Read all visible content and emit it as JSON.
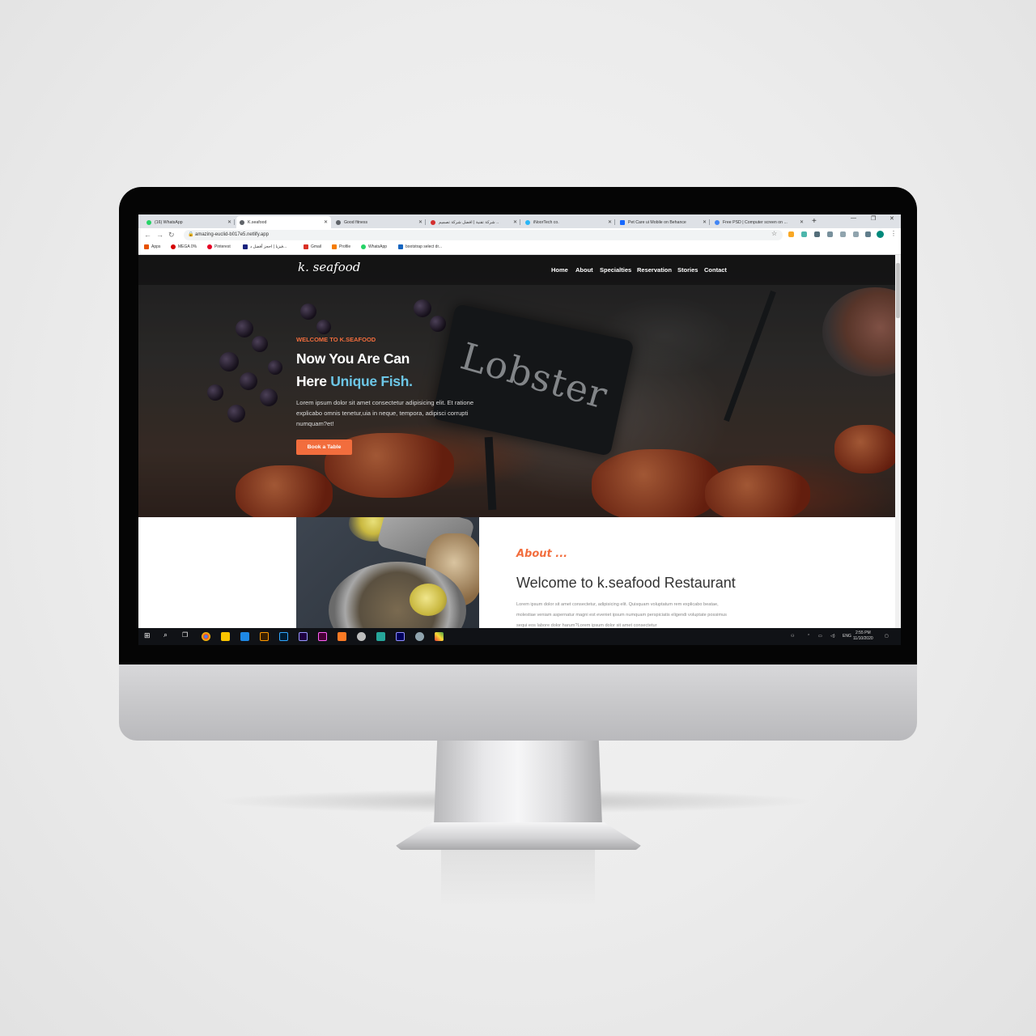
{
  "browser": {
    "tabs": [
      {
        "title": "(16) WhatsApp",
        "color": "#25d366"
      },
      {
        "title": "K.seafood",
        "color": "#5f6368"
      },
      {
        "title": "Good fitness",
        "color": "#5f6368"
      },
      {
        "title": "شركة تقنية | افضل شركة تصميم ..",
        "color": "#d32f2f"
      },
      {
        "title": "iNoorTech co.",
        "color": "#29b6f6"
      },
      {
        "title": "Pet Care ui Mobile on Behance",
        "color": "#1769ff"
      },
      {
        "title": "Free PSD | Computer screen on ...",
        "color": "#4285f4"
      }
    ],
    "new_tab": "+",
    "window_controls": {
      "minimize": "—",
      "restore": "❐",
      "close": "✕"
    },
    "address": "amazing-euclid-b017e5.netlify.app",
    "bookmarks": [
      {
        "label": "Apps",
        "color": "#e65100"
      },
      {
        "label": "MEGA 0%",
        "color": "#d50000"
      },
      {
        "label": "Pinterest",
        "color": "#e60023"
      },
      {
        "label": "فيزيا | احجز أفضل د...",
        "color": "#1a237e"
      },
      {
        "label": "Gmail",
        "color": "#d93025"
      },
      {
        "label": "Profile",
        "color": "#f57c00"
      },
      {
        "label": "WhatsApp",
        "color": "#25d366"
      },
      {
        "label": "bootstrap select dr...",
        "color": "#1565c0"
      }
    ]
  },
  "site": {
    "logo": "k. seafood",
    "nav": [
      "Home",
      "About",
      "Specialties",
      "Reservation",
      "Stories",
      "Contact"
    ],
    "hero": {
      "sign_text": "Lobster",
      "kicker": "WELCOME TO K.SEAFOOD",
      "line1": "Now You Are Can",
      "line2_prefix": "Here ",
      "line2_accent": "Unique Fish.",
      "lede": "Lorem ipsum dolor sit amet consectetur adipisicing elit. Et ratione explicabo omnis tenetur,uia in neque, tempora, adipisci corrupti numquam?et!",
      "cta": "Book a Table"
    },
    "about": {
      "label": "About ...",
      "heading": "Welcome to k.seafood Restaurant",
      "body": "Lorem ipsum dolor sit amet consectetur, adipisicing elit. Quisquam voluptatum rem explicabo beatae, molestiae veniam aspernatur magni est eveniet ipsum numquam perspiciatis eligendi voluptate possimus sequi eos labore dolor harum?Lorem ipsum dolor sit amet consectetur"
    }
  },
  "taskbar": {
    "lang": "ENG",
    "time": "2:55 PM",
    "date": "11/10/2020",
    "apps": [
      "windows",
      "search",
      "task-view",
      "chrome",
      "file-explorer",
      "vscode",
      "illustrator",
      "photoshop",
      "after-effects",
      "xd",
      "xampp",
      "github-desktop",
      "app-e",
      "media-encoder",
      "app-bird",
      "app-grid"
    ]
  },
  "colors": {
    "accent": "#f26d3d",
    "hero_accent": "#6cc6e6"
  }
}
